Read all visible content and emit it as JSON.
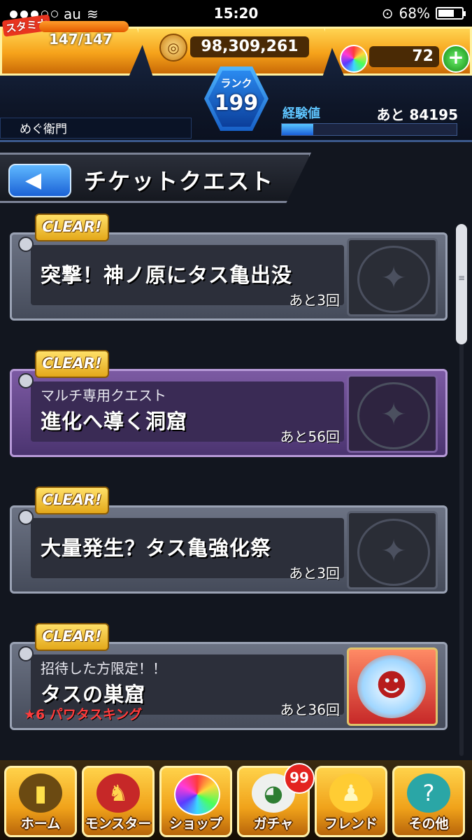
{
  "status_bar": {
    "carrier": "au",
    "time": "15:20",
    "battery": "68%",
    "battery_level": 0.68
  },
  "header": {
    "stamina_label": "スタミナ",
    "stamina": "147/147",
    "stamina_fraction": 1.0,
    "coins": "98,309,261",
    "orbs": "72",
    "rank_label": "ランク",
    "rank": "199",
    "player_name": "めぐ衛門",
    "exp_label": "経験値",
    "exp_remaining": "あと 84195",
    "exp_fraction": 0.18
  },
  "page": {
    "title": "チケットクエスト"
  },
  "quests": [
    {
      "badge": "CLEAR!",
      "subtitle": "",
      "title": "突撃！神ノ原にタス亀出没",
      "remaining": "あと3回",
      "bonus": "",
      "theme": "gray"
    },
    {
      "badge": "CLEAR!",
      "subtitle": "マルチ専用クエスト",
      "title": "進化へ導く洞窟",
      "remaining": "あと56回",
      "bonus": "",
      "theme": "purple"
    },
    {
      "badge": "CLEAR!",
      "subtitle": "",
      "title": "大量発生？タス亀強化祭",
      "remaining": "あと3回",
      "bonus": "",
      "theme": "gray"
    },
    {
      "badge": "CLEAR!",
      "subtitle": "招待した方限定！！",
      "title": "タスの巣窟",
      "remaining": "あと36回",
      "bonus": "★6 パワタスキング",
      "theme": "gray"
    }
  ],
  "nav": {
    "home": "ホーム",
    "monster": "モンスター",
    "shop": "ショップ",
    "gacha": "ガチャ",
    "gacha_badge": "99",
    "friend": "フレンド",
    "other": "その他"
  },
  "icons": {
    "back": "arrow-left",
    "coin": "coin",
    "orb": "rainbow-orb",
    "plus": "plus"
  }
}
